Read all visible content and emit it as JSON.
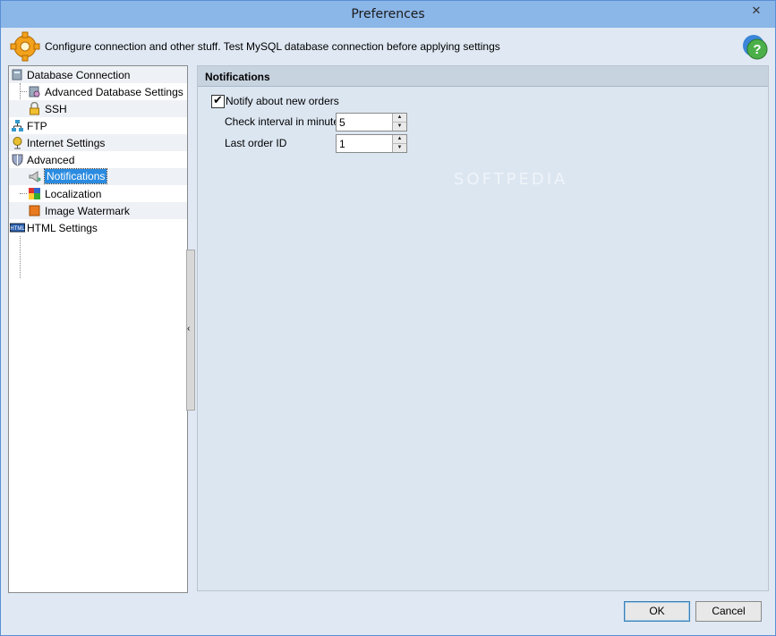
{
  "window": {
    "title": "Preferences",
    "close_glyph": "✕"
  },
  "header": {
    "text": "Configure connection and other stuff. Test MySQL database connection before applying settings",
    "icon": "gear-icon",
    "help_icon": "help-icon"
  },
  "tree": {
    "items": [
      {
        "label": "Database Connection",
        "icon": "database-icon",
        "level": 0
      },
      {
        "label": "Advanced Database Settings",
        "icon": "database-settings-icon",
        "level": 1
      },
      {
        "label": "SSH",
        "icon": "lock-icon",
        "level": 1
      },
      {
        "label": "FTP",
        "icon": "network-icon",
        "level": 0
      },
      {
        "label": "Internet Settings",
        "icon": "globe-icon",
        "level": 0
      },
      {
        "label": "Advanced",
        "icon": "shield-icon",
        "level": 0
      },
      {
        "label": "Notifications",
        "icon": "megaphone-icon",
        "level": 1,
        "selected": true
      },
      {
        "label": "Localization",
        "icon": "flag-icon",
        "level": 1
      },
      {
        "label": "Image Watermark",
        "icon": "image-icon",
        "level": 1
      },
      {
        "label": "HTML Settings",
        "icon": "html-icon",
        "level": 0
      }
    ]
  },
  "panel": {
    "title": "Notifications",
    "notify_label": "Notify about new orders",
    "notify_checked": true,
    "check_interval_label": "Check interval in minutes",
    "check_interval_value": "5",
    "last_order_label": "Last order ID",
    "last_order_value": "1",
    "watermark": "SOFTPEDIA"
  },
  "buttons": {
    "ok": "OK",
    "cancel": "Cancel"
  },
  "colors": {
    "titlebar": "#8bb6e8",
    "selection": "#2a8be0",
    "panel": "#dce6f1"
  }
}
